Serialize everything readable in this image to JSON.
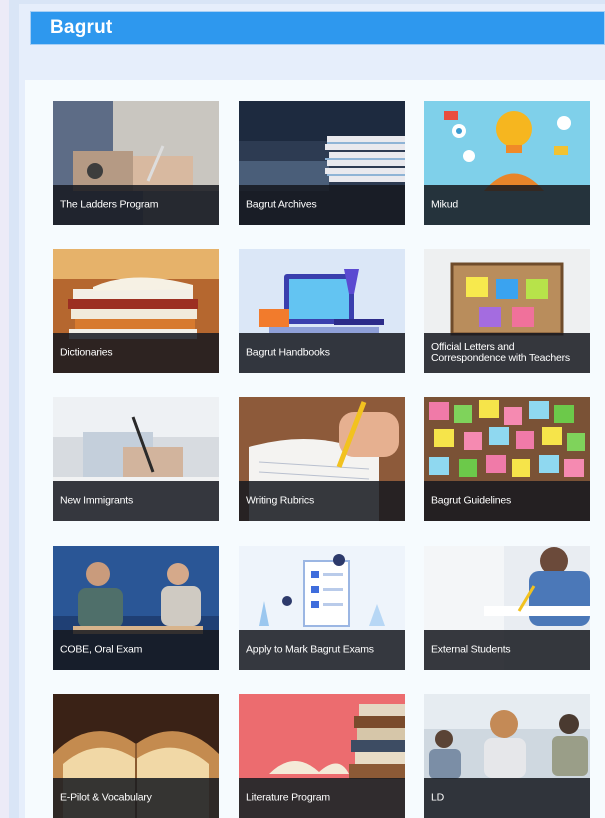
{
  "header": {
    "title": "Bagrut"
  },
  "tiles": [
    {
      "label": "The Ladders Program"
    },
    {
      "label": "Bagrut Archives"
    },
    {
      "label": "Mikud"
    },
    {
      "label": "Dictionaries"
    },
    {
      "label": "Bagrut Handbooks"
    },
    {
      "label": "Official Letters and Correspondence with Teachers"
    },
    {
      "label": "New Immigrants"
    },
    {
      "label": "Writing Rubrics"
    },
    {
      "label": "Bagrut Guidelines"
    },
    {
      "label": "COBE, Oral Exam"
    },
    {
      "label": "Apply to Mark Bagrut Exams"
    },
    {
      "label": "External Students"
    },
    {
      "label": "E-Pilot & Vocabulary"
    },
    {
      "label": "Literature Program"
    },
    {
      "label": "LD"
    }
  ],
  "colors": {
    "header": "#2e98ee",
    "caption_bg": "#16181f"
  }
}
